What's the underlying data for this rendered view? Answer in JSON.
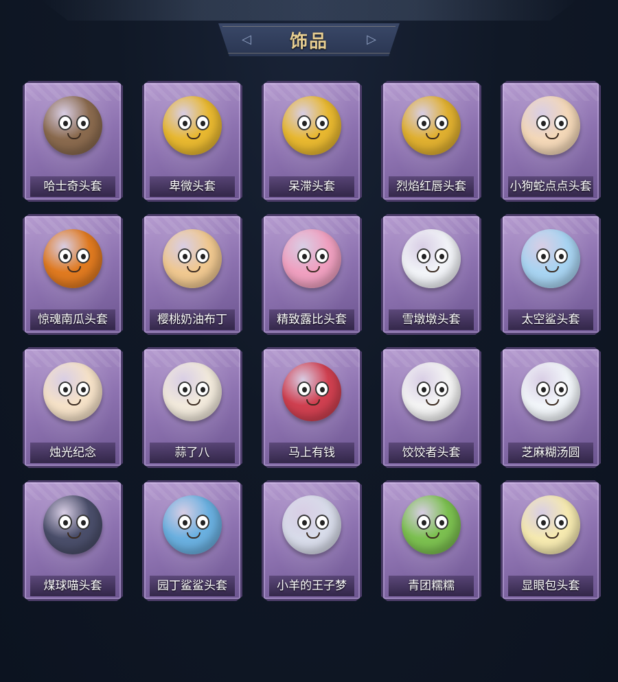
{
  "header": {
    "title": "饰品"
  },
  "items": [
    {
      "label": "哈士奇头套",
      "icon": "husky-mask-icon",
      "color": "#8a6a4e"
    },
    {
      "label": "卑微头套",
      "icon": "humble-emoji-icon",
      "color": "#e8b830"
    },
    {
      "label": "呆滞头套",
      "icon": "dazed-emoji-icon",
      "color": "#e8b830"
    },
    {
      "label": "烈焰红唇头套",
      "icon": "flame-lips-mask-icon",
      "color": "#e0b030"
    },
    {
      "label": "小狗蛇点点头套",
      "icon": "snake-mask-icon",
      "color": "#f4d8b8"
    },
    {
      "label": "惊魂南瓜头套",
      "icon": "pumpkin-mask-icon",
      "color": "#e07a20"
    },
    {
      "label": "樱桃奶油布丁",
      "icon": "pudding-mask-icon",
      "color": "#f0c890"
    },
    {
      "label": "精致露比头套",
      "icon": "loopy-mask-icon",
      "color": "#f0a0c0"
    },
    {
      "label": "雪墩墩头套",
      "icon": "snowman-mask-icon",
      "color": "#f2f4f8"
    },
    {
      "label": "太空鲨头套",
      "icon": "space-shark-mask-icon",
      "color": "#a8d4f2"
    },
    {
      "label": "烛光纪念",
      "icon": "candle-mask-icon",
      "color": "#f6e2c8"
    },
    {
      "label": "蒜了八",
      "icon": "garlic-mask-icon",
      "color": "#f2eadc"
    },
    {
      "label": "马上有钱",
      "icon": "horse-mask-icon",
      "color": "#d04050"
    },
    {
      "label": "饺饺者头套",
      "icon": "dumpling-mask-icon",
      "color": "#f4f4f4"
    },
    {
      "label": "芝麻糊汤圆",
      "icon": "tangyuan-mask-icon",
      "color": "#f2f6fa"
    },
    {
      "label": "煤球喵头套",
      "icon": "black-cat-mask-icon",
      "color": "#4a4e6a"
    },
    {
      "label": "园丁鲨鲨头套",
      "icon": "gardener-shark-mask-icon",
      "color": "#6ab0e0"
    },
    {
      "label": "小羊的王子梦",
      "icon": "sheep-prince-mask-icon",
      "color": "#d8dcea"
    },
    {
      "label": "青团糯糯",
      "icon": "qingtuan-mask-icon",
      "color": "#7cc050"
    },
    {
      "label": "显眼包头套",
      "icon": "lightbulb-mask-icon",
      "color": "#f6eab0"
    }
  ]
}
